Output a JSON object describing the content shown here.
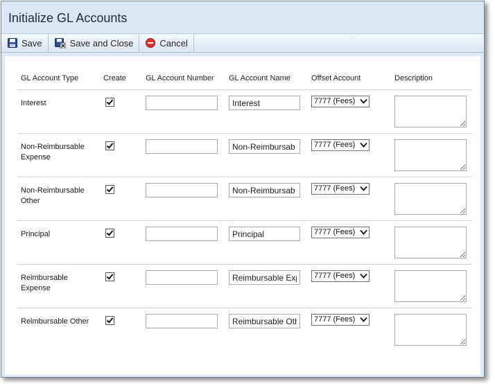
{
  "window": {
    "title": "Initialize GL Accounts"
  },
  "toolbar": {
    "save_label": "Save",
    "save_close_label": "Save and Close",
    "cancel_label": "Cancel"
  },
  "table": {
    "headers": {
      "type": "GL Account Type",
      "create": "Create",
      "number": "GL Account Number",
      "name": "GL Account Name",
      "offset": "Offset Account",
      "description": "Description"
    },
    "rows": [
      {
        "type": "Interest",
        "create": true,
        "number": "",
        "name": "Interest",
        "offset": "7777 (Fees)",
        "description": ""
      },
      {
        "type": "Non-Reimbursable Expense",
        "create": true,
        "number": "",
        "name": "Non-Reimbursab",
        "offset": "7777 (Fees)",
        "description": ""
      },
      {
        "type": "Non-Reimbursable Other",
        "create": true,
        "number": "",
        "name": "Non-Reimbursab",
        "offset": "7777 (Fees)",
        "description": ""
      },
      {
        "type": "Principal",
        "create": true,
        "number": "",
        "name": "Principal",
        "offset": "7777 (Fees)",
        "description": ""
      },
      {
        "type": "Reimbursable Expense",
        "create": true,
        "number": "",
        "name": "Reimbursable Exp",
        "offset": "7777 (Fees)",
        "description": ""
      },
      {
        "type": "Reimbursable Other",
        "create": true,
        "number": "",
        "name": "Reimbursable Oth",
        "offset": "7777 (Fees)",
        "description": ""
      }
    ]
  },
  "colors": {
    "accent": "#dbe7f6",
    "toolbar": "#e6eef8",
    "cancel_icon": "#d9322b"
  }
}
